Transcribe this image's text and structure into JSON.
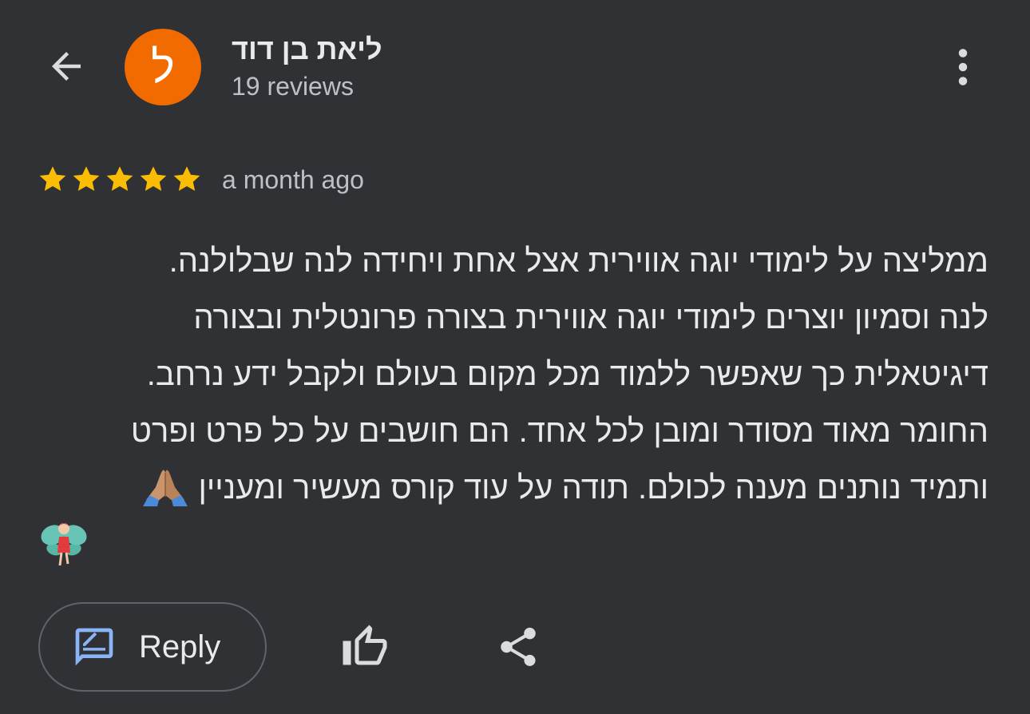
{
  "header": {
    "author_name": "ליאת בן דוד",
    "avatar_letter": "ל",
    "review_count": "19 reviews",
    "icons": {
      "back": "arrow-left-icon",
      "more": "more-vert-icon"
    }
  },
  "review": {
    "rating": 5,
    "rating_max": 5,
    "date": "a month ago",
    "text": "ממליצה על לימודי יוגה אווירית אצל אחת ויחידה לנה שבלולנה.\nלנה וסמיון יוצרים לימודי יוגה אווירית בצורה פרונטלית ובצורה\nדיגיטאלית כך שאפשר ללמוד מכל מקום בעולם ולקבל ידע נרחב.\nהחומר מאוד מסודר ומובן לכל אחד. הם חושבים על כל פרט ופרט\nותמיד נותנים מענה לכולם. תודה על עוד קורס מעשיר ומעניין",
    "emoji": [
      "folded-hands-emoji",
      "fairy-emoji"
    ]
  },
  "actions": {
    "reply_label": "Reply",
    "icons": {
      "reply": "rate-review-icon",
      "like": "thumb-up-icon",
      "share": "share-icon"
    }
  },
  "colors": {
    "background": "#303134",
    "avatar": "#f26b00",
    "star": "#fbbc04",
    "text_primary": "#e8eaed",
    "text_secondary": "#bdc1c6",
    "accent_blue": "#8ab4f8",
    "outline": "#5f6368"
  }
}
